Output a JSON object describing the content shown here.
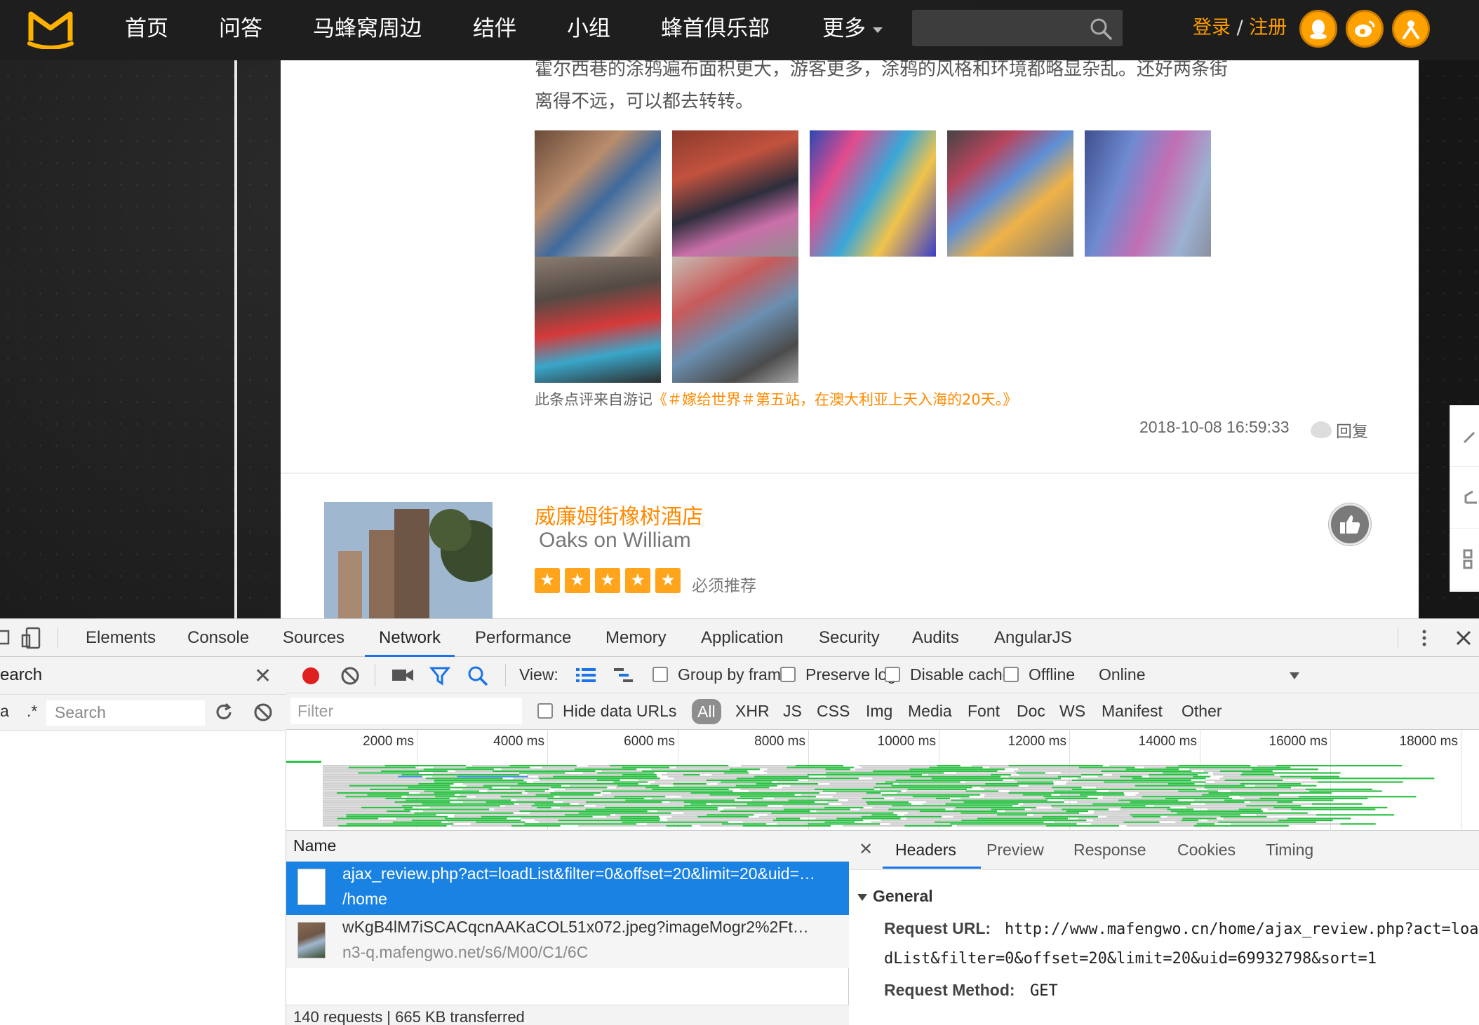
{
  "nav": {
    "items": [
      "首页",
      "问答",
      "马蜂窝周边",
      "结伴",
      "小组",
      "蜂首俱乐部"
    ],
    "more": "更多",
    "login": "登录",
    "separator": "/",
    "register": "注册",
    "accent": "#ff9d00"
  },
  "review": {
    "lines": [
      "霍尔西巷的涂鸦遍布面积更大，游客更多，涂鸦的风格和环境都略显杂乱。还好两条街",
      "离得不远，可以都去转转。"
    ],
    "source_prefix": "此条点评来自游记",
    "source_title": "《＃嫁给世界＃第五站，在澳大利亚上天入海的20天。》",
    "timestamp": "2018-10-08 16:59:33",
    "reply": "回复"
  },
  "hotel": {
    "name_cn": "威廉姆街橡树酒店",
    "name_en": "Oaks on William",
    "stars": 5,
    "rating_label": "必须推荐"
  },
  "devtools": {
    "tabs": [
      "Elements",
      "Console",
      "Sources",
      "Network",
      "Performance",
      "Memory",
      "Application",
      "Security",
      "Audits",
      "AngularJS"
    ],
    "active_tab": "Network",
    "search_panel": {
      "title": "earch",
      "regex": ".*",
      "placeholder": "Search",
      "case_label": "a"
    },
    "toolbar": {
      "view_label": "View:",
      "group_by_frame": "Group by frame",
      "preserve_log": "Preserve log",
      "disable_cache": "Disable cache",
      "offline": "Offline",
      "throttle": "Online"
    },
    "filter": {
      "placeholder": "Filter",
      "hide_data_urls": "Hide data URLs",
      "types": [
        "All",
        "XHR",
        "JS",
        "CSS",
        "Img",
        "Media",
        "Font",
        "Doc",
        "WS",
        "Manifest",
        "Other"
      ]
    },
    "overview_ticks": [
      "2000 ms",
      "4000 ms",
      "6000 ms",
      "8000 ms",
      "10000 ms",
      "12000 ms",
      "14000 ms",
      "16000 ms",
      "18000 ms"
    ],
    "requests": {
      "header": "Name",
      "rows": [
        {
          "name": "ajax_review.php?act=loadList&filter=0&offset=20&limit=20&uid=…",
          "path": "/home"
        },
        {
          "name": "wKgB4lM7iSCACqcnAAKaCOL51x072.jpeg?imageMogr2%2Ft…",
          "path": "n3-q.mafengwo.net/s6/M00/C1/6C"
        }
      ],
      "status": "140 requests | 665 KB transferred"
    },
    "details": {
      "tabs": [
        "Headers",
        "Preview",
        "Response",
        "Cookies",
        "Timing"
      ],
      "active": "Headers",
      "section": "General",
      "request_url_label": "Request URL:",
      "request_url_1": "http://www.mafengwo.cn/home/ajax_review.php?act=loa",
      "request_url_2": "dList&filter=0&offset=20&limit=20&uid=69932798&sort=1",
      "request_method_label": "Request Method:",
      "request_method": "GET"
    }
  }
}
